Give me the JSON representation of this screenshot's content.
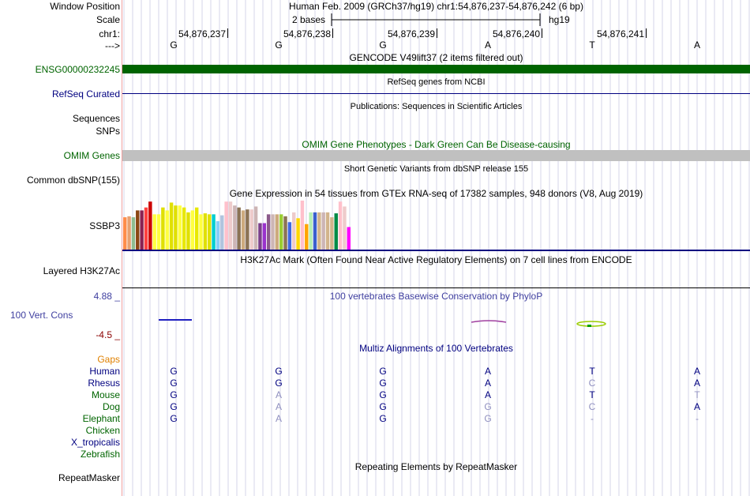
{
  "labels": {
    "window_position": "Window Position",
    "scale": "Scale",
    "chrom": "chr1:",
    "strand": "--->",
    "gene_id": "ENSG00000232245",
    "refseq": "RefSeq Curated",
    "sequences": "Sequences",
    "snps": "SNPs",
    "omim": "OMIM Genes",
    "common_dbsnp": "Common dbSNP(155)",
    "gtex_gene": "SSBP3",
    "h3k27ac": "Layered H3K27Ac",
    "cons_max": "4.88 _",
    "cons_track": "100 Vert. Cons",
    "cons_min": "-4.5 _",
    "gaps": "Gaps"
  },
  "header": {
    "position": "Human Feb. 2009 (GRCh37/hg19)   chr1:54,876,237-54,876,242 (6 bp)",
    "scale_text": "2 bases",
    "assembly": "hg19",
    "coords": [
      "54,876,237",
      "54,876,238",
      "54,876,239",
      "54,876,240",
      "54,876,241"
    ],
    "bases": [
      "G",
      "G",
      "G",
      "A",
      "T",
      "A"
    ]
  },
  "tracks": {
    "gencode_title": "GENCODE V49lift37 (2 items filtered out)",
    "refseq_title": "RefSeq genes from NCBI",
    "pubs_title": "Publications: Sequences in Scientific Articles",
    "omim_title": "OMIM Gene Phenotypes - Dark Green Can Be Disease-causing",
    "dbsnp_title": "Short Genetic Variants from dbSNP release 155",
    "gtex_title": "Gene Expression in 54 tissues from GTEx RNA-seq of 17382 samples, 948 donors (V8, Aug 2019)",
    "h3k27ac_title": "H3K27Ac Mark (Often Found Near Active Regulatory Elements) on 7 cell lines from ENCODE",
    "cons_title": "100 vertebrates Basewise Conservation by PhyloP",
    "multiz_title": "Multiz Alignments of 100 Vertebrates",
    "repeat_title": "Repeating Elements by RepeatMasker",
    "repeat_label": "RepeatMasker"
  },
  "gtex_bars": {
    "values": [
      0.66,
      0.68,
      0.66,
      0.8,
      0.8,
      0.86,
      0.98,
      0.72,
      0.72,
      0.86,
      0.8,
      0.96,
      0.9,
      0.9,
      0.86,
      0.76,
      0.8,
      0.86,
      0.72,
      0.74,
      0.72,
      0.72,
      0.58,
      0.7,
      0.98,
      0.98,
      0.9,
      0.86,
      0.8,
      0.82,
      0.82,
      0.88,
      0.54,
      0.54,
      0.72,
      0.72,
      0.72,
      0.72,
      0.68,
      0.56,
      0.76,
      0.64,
      1.0,
      0.52,
      0.76,
      0.76,
      0.76,
      0.76,
      0.76,
      0.66,
      0.74,
      0.98,
      0.88,
      0.46
    ],
    "colors": [
      "#ff8c4a",
      "#e8a070",
      "#8fbc8f",
      "#8b4513",
      "#8b2252",
      "#ff4040",
      "#cc0000",
      "#ffff40",
      "#ffff40",
      "#e0e000",
      "#ffff40",
      "#e0e000",
      "#e0e000",
      "#ffff40",
      "#e8e800",
      "#e0e000",
      "#ffff40",
      "#e8e800",
      "#ffff40",
      "#e0e000",
      "#e0e000",
      "#00ced1",
      "#87cefa",
      "#b0c4de",
      "#ffc0cb",
      "#eecbcb",
      "#cdb5b5",
      "#8b7355",
      "#cdaa7d",
      "#8b7355",
      "#eecbcb",
      "#cdb5b5",
      "#7b3f8b",
      "#9932cc",
      "#8b5a8b",
      "#cdb5b5",
      "#cdaa7d",
      "#9acd32",
      "#8b7355",
      "#4169e1",
      "#eecbcb",
      "#ffd700",
      "#ffc0cb",
      "#ffa500",
      "#b4eeb4",
      "#3a5fcd",
      "#d2b48c",
      "#cdb5b5",
      "#d2b48c",
      "#d2b48c",
      "#008b45",
      "#ffc0cb",
      "#eecbcb",
      "#ff00ff"
    ]
  },
  "multiz": {
    "species": [
      {
        "name": "Human",
        "color": "#000080",
        "bases": [
          "G",
          "G",
          "G",
          "A",
          "T",
          "A"
        ],
        "conserved": [
          true,
          true,
          true,
          true,
          true,
          true
        ]
      },
      {
        "name": "Rhesus",
        "color": "#000080",
        "bases": [
          "G",
          "G",
          "G",
          "A",
          "C",
          "A"
        ],
        "conserved": [
          true,
          true,
          true,
          true,
          false,
          true
        ]
      },
      {
        "name": "Mouse",
        "color": "#006400",
        "bases": [
          "G",
          "A",
          "G",
          "A",
          "T",
          "T"
        ],
        "conserved": [
          true,
          false,
          true,
          true,
          true,
          false
        ]
      },
      {
        "name": "Dog",
        "color": "#006400",
        "bases": [
          "G",
          "A",
          "G",
          "G",
          "C",
          "A"
        ],
        "conserved": [
          true,
          false,
          true,
          false,
          false,
          true
        ]
      },
      {
        "name": "Elephant",
        "color": "#006400",
        "bases": [
          "G",
          "A",
          "G",
          "G",
          "-",
          "-"
        ],
        "conserved": [
          true,
          false,
          true,
          false,
          false,
          false
        ]
      },
      {
        "name": "Chicken",
        "color": "#006400",
        "bases": [],
        "conserved": []
      },
      {
        "name": "X_tropicalis",
        "color": "#000080",
        "bases": [],
        "conserved": []
      },
      {
        "name": "Zebrafish",
        "color": "#006400",
        "bases": [],
        "conserved": []
      }
    ]
  },
  "colors": {
    "gencode": "#006400",
    "refseq": "#000080",
    "omim_bar": "#c0c0c0",
    "divider": "#f0a0a0",
    "grid": "#d4d4e8"
  }
}
